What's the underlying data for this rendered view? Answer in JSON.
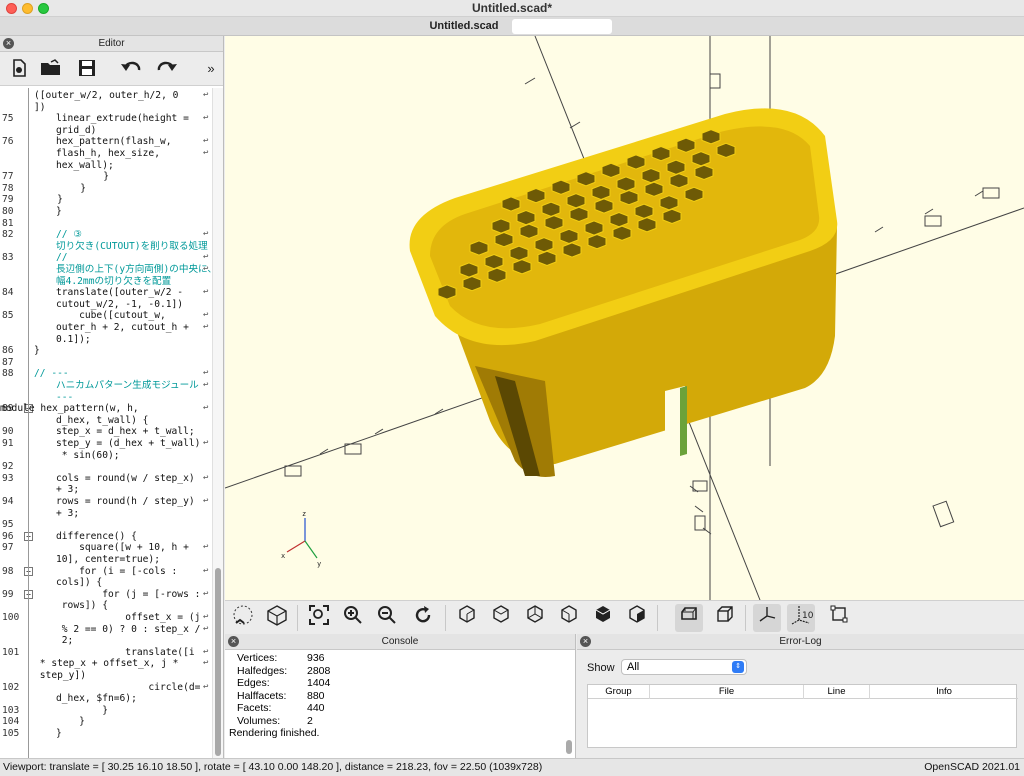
{
  "window": {
    "title": "Untitled.scad*"
  },
  "tabs": [
    {
      "label": "Untitled.scad"
    }
  ],
  "editor": {
    "title": "Editor",
    "close_glyph": "×",
    "toolbar": [
      "new-file-icon",
      "open-file-icon",
      "save-icon",
      "undo-icon",
      "redo-icon",
      "more-icon"
    ],
    "lines": [
      {
        "n": "",
        "t": "([outer_w/2, outer_h/2, 0",
        "w": true
      },
      {
        "n": "",
        "t": "])"
      },
      {
        "n": "75",
        "t": "linear_extrude(height =",
        "w": true,
        "i": 1
      },
      {
        "n": "",
        "t": "grid_d)",
        "i": 1
      },
      {
        "n": "76",
        "t": "hex_pattern(flash_w,",
        "w": true,
        "i": 1
      },
      {
        "n": "",
        "t": "flash_h, hex_size,",
        "w": true,
        "i": 1
      },
      {
        "n": "",
        "t": "hex_wall);",
        "i": 1
      },
      {
        "n": "77",
        "t": "            }"
      },
      {
        "n": "78",
        "t": "        }"
      },
      {
        "n": "79",
        "t": "    }"
      },
      {
        "n": "80",
        "t": "}",
        "i": 1
      },
      {
        "n": "81",
        "t": ""
      },
      {
        "n": "82",
        "t": "// ③",
        "w": true,
        "c": true,
        "i": 1
      },
      {
        "n": "",
        "t": "切り欠き(CUTOUT)を削り取る処理",
        "c": true,
        "i": 1
      },
      {
        "n": "83",
        "t": "//",
        "w": true,
        "c": true,
        "i": 1
      },
      {
        "n": "",
        "t": "長辺側の上下(y方向両側)の中央に、",
        "w": true,
        "c": true,
        "i": 1
      },
      {
        "n": "",
        "t": "幅4.2mmの切り欠きを配置",
        "c": true,
        "i": 1
      },
      {
        "n": "84",
        "t": "translate([outer_w/2 -",
        "w": true,
        "i": 1
      },
      {
        "n": "",
        "t": "cutout_w/2, -1, -0.1])",
        "i": 1
      },
      {
        "n": "85",
        "t": "    cube([cutout_w,",
        "w": true,
        "i": 1
      },
      {
        "n": "",
        "t": "outer_h + 2, cutout_h +",
        "w": true,
        "i": 1
      },
      {
        "n": "",
        "t": "0.1]);",
        "i": 1
      },
      {
        "n": "86",
        "t": "}"
      },
      {
        "n": "87",
        "t": ""
      },
      {
        "n": "88",
        "t": "// ---",
        "w": true,
        "c": true
      },
      {
        "n": "",
        "t": "ハニカムパターン生成モジュール",
        "w": true,
        "c": true,
        "i": 1
      },
      {
        "n": "",
        "t": "---",
        "c": true,
        "i": 1
      },
      {
        "n": "89",
        "t": "module hex_pattern(w, h,",
        "w": true,
        "m": true
      },
      {
        "n": "",
        "t": "d_hex, t_wall) {",
        "i": 1
      },
      {
        "n": "90",
        "t": "step_x = d_hex + t_wall;",
        "i": 1
      },
      {
        "n": "91",
        "t": "step_y = (d_hex + t_wall)",
        "w": true,
        "i": 1
      },
      {
        "n": "",
        "t": " * sin(60);",
        "i": 1
      },
      {
        "n": "92",
        "t": ""
      },
      {
        "n": "93",
        "t": "cols = round(w / step_x)",
        "w": true,
        "i": 1
      },
      {
        "n": "",
        "t": "+ 3;",
        "i": 1
      },
      {
        "n": "94",
        "t": "rows = round(h / step_y)",
        "w": true,
        "i": 1
      },
      {
        "n": "",
        "t": "+ 3;",
        "i": 1
      },
      {
        "n": "95",
        "t": ""
      },
      {
        "n": "96",
        "t": "difference() {",
        "i": 1
      },
      {
        "n": "97",
        "t": "    square([w + 10, h +",
        "w": true,
        "i": 1
      },
      {
        "n": "",
        "t": "10], center=true);",
        "i": 1
      },
      {
        "n": "98",
        "t": "    for (i = [-cols :",
        "w": true,
        "i": 1
      },
      {
        "n": "",
        "t": "cols]) {",
        "i": 1
      },
      {
        "n": "99",
        "t": "        for (j = [-rows :",
        "w": true,
        "i": 1
      },
      {
        "n": "",
        "t": " rows]) {",
        "i": 1
      },
      {
        "n": "100",
        "t": "            offset_x = (j",
        "w": true,
        "i": 1
      },
      {
        "n": "",
        "t": " % 2 == 0) ? 0 : step_x /",
        "w": true,
        "i": 1
      },
      {
        "n": "",
        "t": " 2;",
        "i": 1
      },
      {
        "n": "101",
        "t": "            translate([i",
        "w": true,
        "i": 1
      },
      {
        "n": "",
        "t": " * step_x + offset_x, j *",
        "w": true
      },
      {
        "n": "",
        "t": " step_y])"
      },
      {
        "n": "102",
        "t": "                circle(d=",
        "w": true,
        "i": 1
      },
      {
        "n": "",
        "t": "d_hex, $fn=6);",
        "i": 1
      },
      {
        "n": "103",
        "t": "        }",
        "i": 1
      },
      {
        "n": "104",
        "t": "    }",
        "i": 1
      },
      {
        "n": "105",
        "t": "}",
        "i": 1
      }
    ]
  },
  "viewport": {
    "background": "#fffde6",
    "model_color": "#e8c30e",
    "axis_labels": {
      "x": "x",
      "y": "y",
      "z": "z"
    }
  },
  "view_toolbar": {
    "buttons": [
      "preview-icon",
      "render-icon",
      "view-all-icon",
      "zoom-in-icon",
      "zoom-out-icon",
      "reset-view-icon",
      "view-right-icon",
      "view-top-icon",
      "view-bottom-icon",
      "view-left-icon",
      "view-front-icon",
      "view-back-icon",
      "perspective-icon",
      "orthogonal-icon",
      "show-axes-icon",
      "show-scale-icon",
      "show-edges-icon"
    ],
    "scale_label": "10"
  },
  "console": {
    "title": "Console",
    "stats": [
      {
        "key": "Vertices:",
        "value": "936"
      },
      {
        "key": "Halfedges:",
        "value": "2808"
      },
      {
        "key": "Edges:",
        "value": "1404"
      },
      {
        "key": "Halffacets:",
        "value": "880"
      },
      {
        "key": "Facets:",
        "value": "440"
      },
      {
        "key": "Volumes:",
        "value": "2"
      }
    ],
    "last_line": "Rendering finished."
  },
  "error_log": {
    "title": "Error-Log",
    "show_label": "Show",
    "show_value": "All",
    "columns": [
      "Group",
      "File",
      "Line",
      "Info"
    ]
  },
  "status": {
    "viewport": "Viewport: translate = [ 30.25 16.10 18.50 ], rotate = [ 43.10 0.00 148.20 ], distance = 218.23, fov = 22.50 (1039x728)",
    "version": "OpenSCAD 2021.01"
  }
}
